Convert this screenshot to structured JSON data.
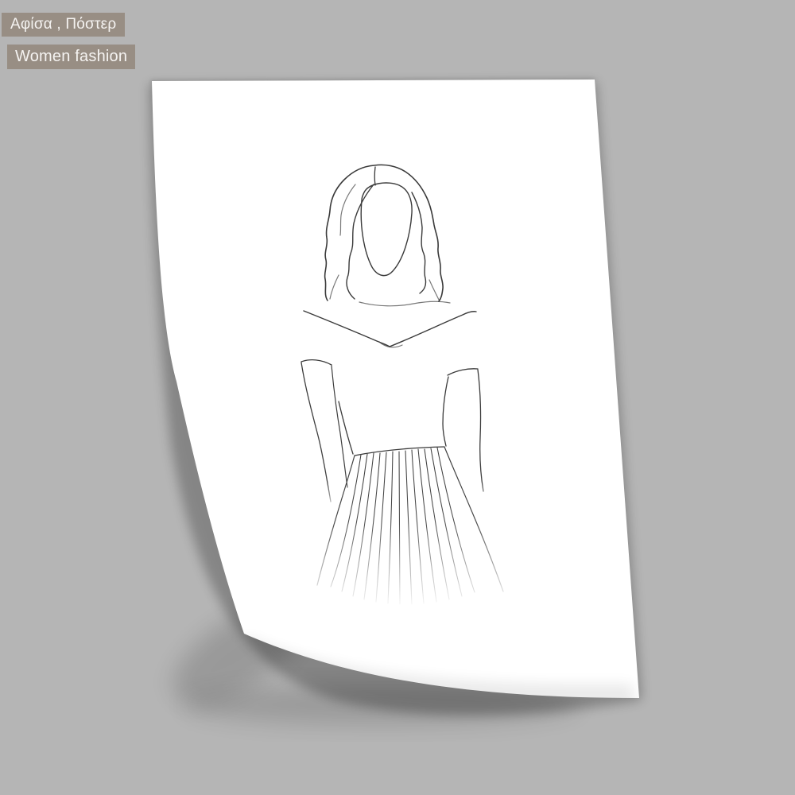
{
  "colors": {
    "page_bg": "#b5b5b5",
    "tag_bg": "#988e84",
    "tag_text": "#f5f3f1",
    "paper": "#ffffff",
    "line": "#3a3a3a"
  },
  "tags": {
    "items": [
      {
        "label": "Αφίσα , Πόστερ"
      },
      {
        "label": "Women fashion"
      }
    ]
  },
  "poster": {
    "artwork": "woman-fashion-line-art"
  }
}
